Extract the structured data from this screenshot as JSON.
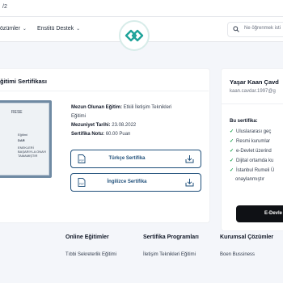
{
  "browser": {
    "url_fragment": "/2"
  },
  "header": {
    "nav": [
      {
        "label": "özümler"
      },
      {
        "label": "Enstitü Destek"
      }
    ],
    "search": {
      "placeholder": "Ne öğrenmek isti"
    }
  },
  "certificate_card": {
    "title": "ğitimi Sertifikası",
    "certificate_image_lines": [
      "RESE",
      "Eğitimi",
      "DAR",
      "ENEKLERİ",
      "BAŞARIYLA ONAYI",
      "TAMAMIŞTIR"
    ],
    "details": [
      {
        "label": "Mezun Olunan Eğitim:",
        "value": "Etkili İletişim Teknikleri",
        "value_cont": "Eğitimi"
      },
      {
        "label": "Mezuniyet Tarihi:",
        "value": "23.08.2022"
      },
      {
        "label": "Sertifika Notu:",
        "value": "60.00 Puan"
      }
    ],
    "buttons": [
      {
        "label": "Türkçe Sertifika",
        "file_icon": "pdf",
        "action_icon": "download-icon"
      },
      {
        "label": "İngilizce Sertifika",
        "file_icon": "pdf",
        "action_icon": "download-icon"
      }
    ]
  },
  "user_card": {
    "name": "Yaşar Kaan Çavd",
    "email": "kaan.cavdar.1997@g",
    "benefits_title": "Bu sertifika:",
    "benefits": [
      "Uluslararası geç",
      "Resmi kurumlar",
      "e-Devlet üzerind",
      "Dijital ortamda ku",
      "İstanbul Rumeli Ü"
    ],
    "benefits_tail": "onaylanmıştır",
    "edevlet_button": "E-Devle"
  },
  "footer": {
    "columns": [
      {
        "heading": "Online Eğitimler",
        "link": "Tıbbi Sekreterlik Eğitimi"
      },
      {
        "heading": "Sertifika Programları",
        "link": "İletişim Teknikleri Eğitimi"
      },
      {
        "heading": "Kurumsal Çözümler",
        "link": "Boen Bussiness"
      }
    ]
  },
  "colors": {
    "accent": "#1f4f7a",
    "check": "#16a34a",
    "logo_teal": "#1fa39a",
    "dark_button": "#0f1115"
  }
}
